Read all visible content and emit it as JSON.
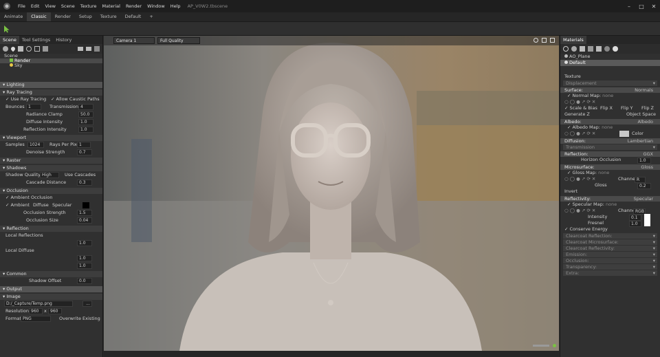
{
  "titlebar": {
    "menus": [
      "File",
      "Edit",
      "View",
      "Scene",
      "Texture",
      "Material",
      "Render",
      "Window",
      "Help"
    ],
    "doc_title": "AP_V0W2.tbscene",
    "window_buttons": [
      "–",
      "□",
      "✕"
    ]
  },
  "mode_tabs": [
    "Animate",
    "Classic",
    "Render",
    "Setup",
    "Texture",
    "Default",
    "+"
  ],
  "left_panel": {
    "tabs": [
      "Scene",
      "Tool Settings",
      "History"
    ],
    "tree": [
      "Scene",
      "Render",
      "Sky"
    ],
    "lighting_header": "Lighting",
    "ray_tracing": {
      "header": "Ray Tracing",
      "use_ray_tracing": "Use Ray Tracing",
      "allow_caustic": "Allow Caustic Paths",
      "bounces_label": "Bounces",
      "bounces": "1",
      "transmission_label": "Transmission",
      "transmission": "4",
      "radiance_clamp_label": "Radiance Clamp",
      "radiance_clamp": "50.0",
      "diffuse_intensity_label": "Diffuse Intensity",
      "diffuse_intensity": "1.0",
      "reflection_intensity_label": "Reflection Intensity",
      "reflection_intensity": "1.0"
    },
    "viewport": {
      "header": "Viewport",
      "samples_label": "Samples",
      "samples": "1024",
      "rays_label": "Rays Per Pixel",
      "rays": "1",
      "denoise_label": "Denoise Strength",
      "denoise": "0.7"
    },
    "raster_header": "Raster",
    "shadows": {
      "header": "Shadows",
      "quality_label": "Shadow Quality",
      "quality": "High",
      "use_cascades": "Use Cascades",
      "cascade_label": "Cascade Distance",
      "cascade": "0.3"
    },
    "occlusion": {
      "header": "Occlusion",
      "ambient_occlusion": "Ambient Occlusion",
      "ambient": "Ambient",
      "diffuse": "Diffuse",
      "specular": "Specular",
      "strength_label": "Occlusion Strength",
      "strength": "1.5",
      "size_label": "Occlusion Size",
      "size": "0.04"
    },
    "reflection": {
      "header": "Reflection",
      "local_reflections": "Local Reflections",
      "lr_value": "1.0",
      "local_diffuse": "Local Diffuse",
      "ld_value1": "1.0",
      "ld_value2": "1.0"
    },
    "common": {
      "header": "Common",
      "shadow_offset_label": "Shadow Offset",
      "shadow_offset": "0.0"
    },
    "output": {
      "header": "Output",
      "image_header": "Image",
      "path": "D:/_Capture/Temp.png",
      "browse": "...",
      "resolution_label": "Resolution:",
      "res_w": "960",
      "res_x": "x",
      "res_h": "960",
      "format_label": "Format",
      "format": "PNG",
      "overwrite": "Overwrite Existing"
    }
  },
  "viewport": {
    "camera": "Camera 1",
    "quality": "Full Quality"
  },
  "right_panel": {
    "tab": "Materials",
    "materials": [
      "AO_Plane",
      "Default"
    ],
    "texture_header": "Texture",
    "displacement": "Displacement",
    "surface": {
      "label": "Surface:",
      "value": "Normals"
    },
    "normal_map": {
      "label": "Normal Map:",
      "value": "none"
    },
    "scale_bias": "Scale & Bias",
    "flip_x": "Flip X",
    "flip_y": "Flip Y",
    "flip_z": "Flip Z",
    "generate_z": "Generate Z",
    "object_space": "Object Space",
    "albedo": {
      "label": "Albedo:",
      "value": "Albedo"
    },
    "albedo_map": {
      "label": "Albedo Map:",
      "value": "none"
    },
    "color_label": "Color",
    "diffusion": {
      "label": "Diffusion:",
      "value": "Lambertian"
    },
    "transmission": "Transmission",
    "reflection": {
      "label": "Reflection:",
      "value": "GGX"
    },
    "horizon_occlusion": {
      "label": "Horizon Occlusion",
      "value": "1.0"
    },
    "microsurface": {
      "label": "Microsurface:",
      "value": "Gloss"
    },
    "gloss_map": {
      "label": "Gloss Map:",
      "value": "none"
    },
    "channel_label": "Channel",
    "channel_r": "R",
    "gloss": {
      "label": "Gloss",
      "value": "0.2"
    },
    "invert": "Invert",
    "reflectivity": {
      "label": "Reflectivity:",
      "value": "Specular"
    },
    "specular_map": {
      "label": "Specular Map:",
      "value": "none"
    },
    "channel_rgb": "RGB",
    "intensity": {
      "label": "Intensity",
      "value": "0.1"
    },
    "fresnel": {
      "label": "Fresnel",
      "value": "1.0"
    },
    "conserve_energy": "Conserve Energy",
    "collapsed": [
      "Clearcoat Reflection:",
      "Clearcoat Microsurface:",
      "Clearcoat Reflectivity:",
      "Emission:",
      "Occlusion:",
      "Transparency:",
      "Extra:"
    ]
  },
  "colors": {
    "accent_green": "#7ac143",
    "panel": "#303030",
    "header": "#4a4a4a"
  }
}
